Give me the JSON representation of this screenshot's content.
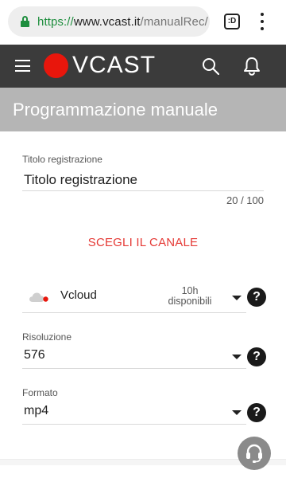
{
  "browser": {
    "url_scheme": "https://",
    "url_host": "www.vcast.it",
    "url_path": "/manualRec/",
    "tab_switcher": ":D"
  },
  "app_bar": {
    "logo_text": "VCAST"
  },
  "page": {
    "title": "Programmazione manuale"
  },
  "form": {
    "title_field": {
      "label": "Titolo registrazione",
      "value": "Titolo registrazione",
      "counter": "20 / 100"
    },
    "choose_channel_label": "SCEGLI IL CANALE",
    "channel": {
      "name": "Vcloud",
      "hours_line1": "10h",
      "hours_line2": "disponibili",
      "help": "?"
    },
    "resolution": {
      "label": "Risoluzione",
      "value": "576",
      "help": "?"
    },
    "format": {
      "label": "Formato",
      "value": "mp4",
      "help": "?"
    }
  },
  "colors": {
    "app_bar_bg": "#3b3b3b",
    "title_band_bg": "#b5b5b5",
    "brand_red": "#e8160c",
    "accent_red": "#e53935",
    "secure_green": "#1e8e3e"
  },
  "icons": [
    "lock-icon",
    "tab-switcher-icon",
    "more-options-icon",
    "menu-icon",
    "search-icon",
    "notifications-icon",
    "cloud-icon",
    "help-icon",
    "caret-down-icon",
    "headset-icon"
  ]
}
